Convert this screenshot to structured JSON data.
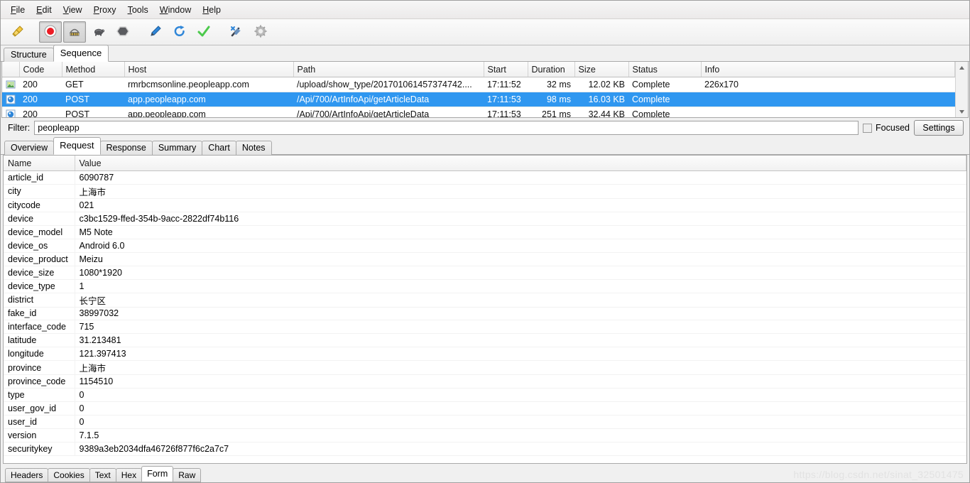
{
  "menubar": {
    "items": [
      {
        "label": "File",
        "mnemonic": "F"
      },
      {
        "label": "Edit",
        "mnemonic": "E"
      },
      {
        "label": "View",
        "mnemonic": "V"
      },
      {
        "label": "Proxy",
        "mnemonic": "P"
      },
      {
        "label": "Tools",
        "mnemonic": "T"
      },
      {
        "label": "Window",
        "mnemonic": "W"
      },
      {
        "label": "Help",
        "mnemonic": "H"
      }
    ]
  },
  "toolbar": {
    "buttons": [
      {
        "name": "clear-session-icon",
        "title": "Clear Session"
      },
      {
        "name": "record-icon",
        "title": "Start/Stop Recording",
        "pressed": true
      },
      {
        "name": "throttle-settings-icon",
        "title": "Throttle Settings",
        "pressed": true
      },
      {
        "name": "throttle-turtle-icon",
        "title": "Start/Stop Throttling"
      },
      {
        "name": "breakpoint-hexagon-icon",
        "title": "Enable/Disable Breakpoints"
      },
      {
        "name": "compose-pen-icon",
        "title": "Compose"
      },
      {
        "name": "repeat-refresh-icon",
        "title": "Repeat"
      },
      {
        "name": "validate-check-icon",
        "title": "Validate"
      },
      {
        "name": "tools-icon",
        "title": "Tools"
      },
      {
        "name": "settings-gear-icon",
        "title": "Settings"
      }
    ]
  },
  "top_tabs": {
    "items": [
      "Structure",
      "Sequence"
    ],
    "selected": "Sequence"
  },
  "session_table": {
    "columns": [
      "",
      "Code",
      "Method",
      "Host",
      "Path",
      "Start",
      "Duration",
      "Size",
      "Status",
      "Info"
    ],
    "rows": [
      {
        "icon": "image-file-icon",
        "code": "200",
        "method": "GET",
        "host": "rmrbcmsonline.peopleapp.com",
        "path": "/upload/show_type/201701061457374742....",
        "start": "17:11:52",
        "duration": "32 ms",
        "size": "12.02 KB",
        "status": "Complete",
        "info": "226x170",
        "selected": false
      },
      {
        "icon": "json-file-icon",
        "code": "200",
        "method": "POST",
        "host": "app.peopleapp.com",
        "path": "/Api/700/ArtInfoApi/getArticleData",
        "start": "17:11:53",
        "duration": "98 ms",
        "size": "16.03 KB",
        "status": "Complete",
        "info": "",
        "selected": true
      },
      {
        "icon": "json-file-icon",
        "code": "200",
        "method": "POST",
        "host": "app.peopleapp.com",
        "path": "/Api/700/ArtInfoApi/getArticleData",
        "start": "17:11:53",
        "duration": "251 ms",
        "size": "32.44 KB",
        "status": "Complete",
        "info": "",
        "selected": false
      }
    ],
    "selection_color": "#2f97f0"
  },
  "filter_bar": {
    "label": "Filter:",
    "value": "peopleapp",
    "placeholder": "",
    "focused_label": "Focused",
    "focused_checked": false,
    "settings_label": "Settings"
  },
  "mid_tabs": {
    "items": [
      "Overview",
      "Request",
      "Response",
      "Summary",
      "Chart",
      "Notes"
    ],
    "selected": "Request"
  },
  "form_table": {
    "columns": [
      "Name",
      "Value"
    ],
    "rows": [
      {
        "name": "article_id",
        "value": "6090787"
      },
      {
        "name": "city",
        "value": "上海市"
      },
      {
        "name": "citycode",
        "value": "021"
      },
      {
        "name": "device",
        "value": "c3bc1529-ffed-354b-9acc-2822df74b116"
      },
      {
        "name": "device_model",
        "value": "M5 Note"
      },
      {
        "name": "device_os",
        "value": "Android 6.0"
      },
      {
        "name": "device_product",
        "value": "Meizu"
      },
      {
        "name": "device_size",
        "value": "1080*1920"
      },
      {
        "name": "device_type",
        "value": "1"
      },
      {
        "name": "district",
        "value": "长宁区"
      },
      {
        "name": "fake_id",
        "value": "38997032"
      },
      {
        "name": "interface_code",
        "value": "715"
      },
      {
        "name": "latitude",
        "value": "31.213481"
      },
      {
        "name": "longitude",
        "value": "121.397413"
      },
      {
        "name": "province",
        "value": "上海市"
      },
      {
        "name": "province_code",
        "value": "1154510"
      },
      {
        "name": "type",
        "value": "0"
      },
      {
        "name": "user_gov_id",
        "value": "0"
      },
      {
        "name": "user_id",
        "value": "0"
      },
      {
        "name": "version",
        "value": "7.1.5"
      },
      {
        "name": "securitykey",
        "value": "9389a3eb2034dfa46726f877f6c2a7c7"
      }
    ]
  },
  "bottom_tabs": {
    "items": [
      "Headers",
      "Cookies",
      "Text",
      "Hex",
      "Form",
      "Raw"
    ],
    "selected": "Form"
  },
  "watermark": {
    "text": "https://blog.csdn.net/sinat_32501475"
  }
}
